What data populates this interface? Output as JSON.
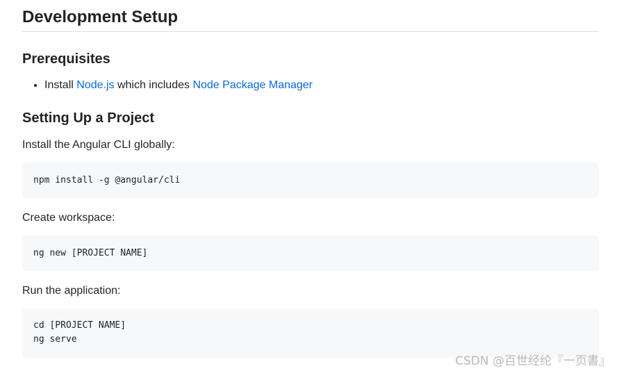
{
  "heading": "Development Setup",
  "prerequisites": {
    "title": "Prerequisites",
    "item": {
      "prefix": "Install ",
      "link1": "Node.js",
      "middle": " which includes ",
      "link2": "Node Package Manager"
    }
  },
  "setup": {
    "title": "Setting Up a Project",
    "step1": {
      "text": "Install the Angular CLI globally:",
      "code": "npm install -g @angular/cli"
    },
    "step2": {
      "text": "Create workspace:",
      "code": "ng new [PROJECT NAME]"
    },
    "step3": {
      "text": "Run the application:",
      "code": "cd [PROJECT NAME]\nng serve"
    }
  },
  "watermark": "CSDN @百世经纶『一页書』",
  "colors": {
    "link": "#0969da",
    "code_bg": "#f6f8fa",
    "text": "#1f2328"
  }
}
